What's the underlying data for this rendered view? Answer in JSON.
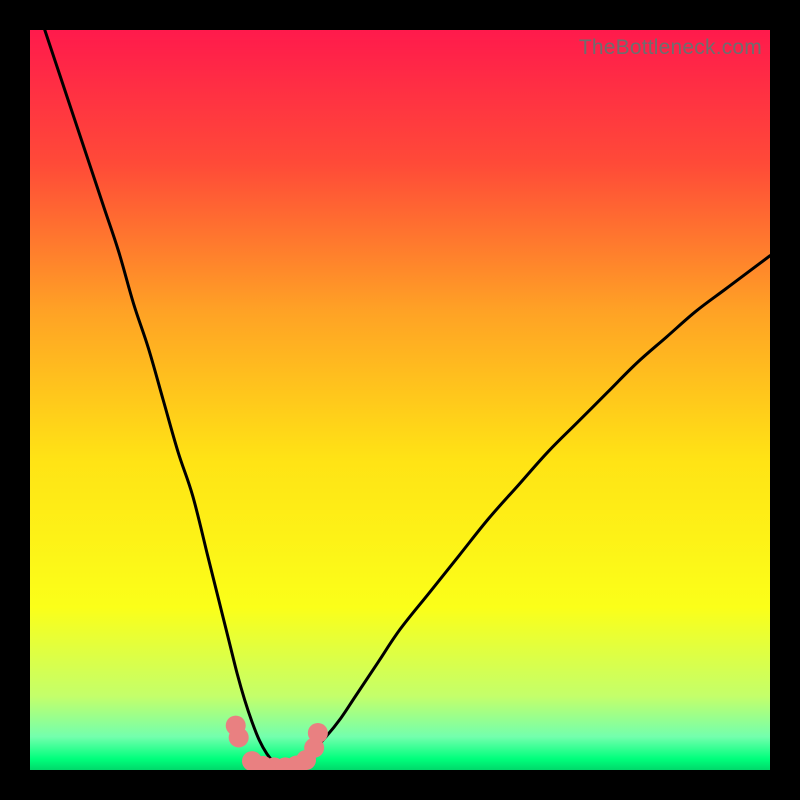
{
  "watermark": "TheBottleneck.com",
  "chart_data": {
    "type": "line",
    "title": "",
    "xlabel": "",
    "ylabel": "",
    "xlim": [
      0,
      100
    ],
    "ylim": [
      0,
      100
    ],
    "grid": false,
    "legend": false,
    "background_gradient": {
      "stops": [
        {
          "pos": 0.0,
          "color": "#ff1a4c"
        },
        {
          "pos": 0.18,
          "color": "#ff4a38"
        },
        {
          "pos": 0.38,
          "color": "#ffa225"
        },
        {
          "pos": 0.58,
          "color": "#ffe315"
        },
        {
          "pos": 0.78,
          "color": "#fbff19"
        },
        {
          "pos": 0.9,
          "color": "#c4ff6a"
        },
        {
          "pos": 0.955,
          "color": "#73ffad"
        },
        {
          "pos": 0.985,
          "color": "#00ff7c"
        },
        {
          "pos": 1.0,
          "color": "#00d86a"
        }
      ]
    },
    "series": [
      {
        "name": "curve-left",
        "stroke": "#000000",
        "x": [
          2,
          4,
          6,
          8,
          10,
          12,
          14,
          16,
          18,
          20,
          22,
          24,
          25,
          26,
          27,
          28,
          29,
          30,
          31,
          32,
          33,
          34
        ],
        "y": [
          100,
          94,
          88,
          82,
          76,
          70,
          63,
          57,
          50,
          43,
          37,
          29,
          25,
          21,
          17,
          13,
          9.5,
          6.5,
          4,
          2.2,
          1,
          0.3
        ]
      },
      {
        "name": "curve-right",
        "stroke": "#000000",
        "x": [
          34,
          36,
          38,
          40,
          42,
          44,
          47,
          50,
          54,
          58,
          62,
          66,
          70,
          74,
          78,
          82,
          86,
          90,
          94,
          98,
          100
        ],
        "y": [
          0.3,
          1,
          2.4,
          4.5,
          7,
          10,
          14.5,
          19,
          24,
          29,
          34,
          38.5,
          43,
          47,
          51,
          55,
          58.5,
          62,
          65,
          68,
          69.5
        ]
      },
      {
        "name": "valley-markers",
        "type": "scatter",
        "color": "#e98081",
        "x": [
          27.8,
          28.2,
          30.0,
          31.5,
          33.0,
          34.5,
          36.0,
          37.3,
          38.4,
          38.9
        ],
        "y": [
          6.0,
          4.4,
          1.2,
          0.55,
          0.35,
          0.35,
          0.6,
          1.35,
          3.0,
          5.0
        ]
      }
    ]
  }
}
